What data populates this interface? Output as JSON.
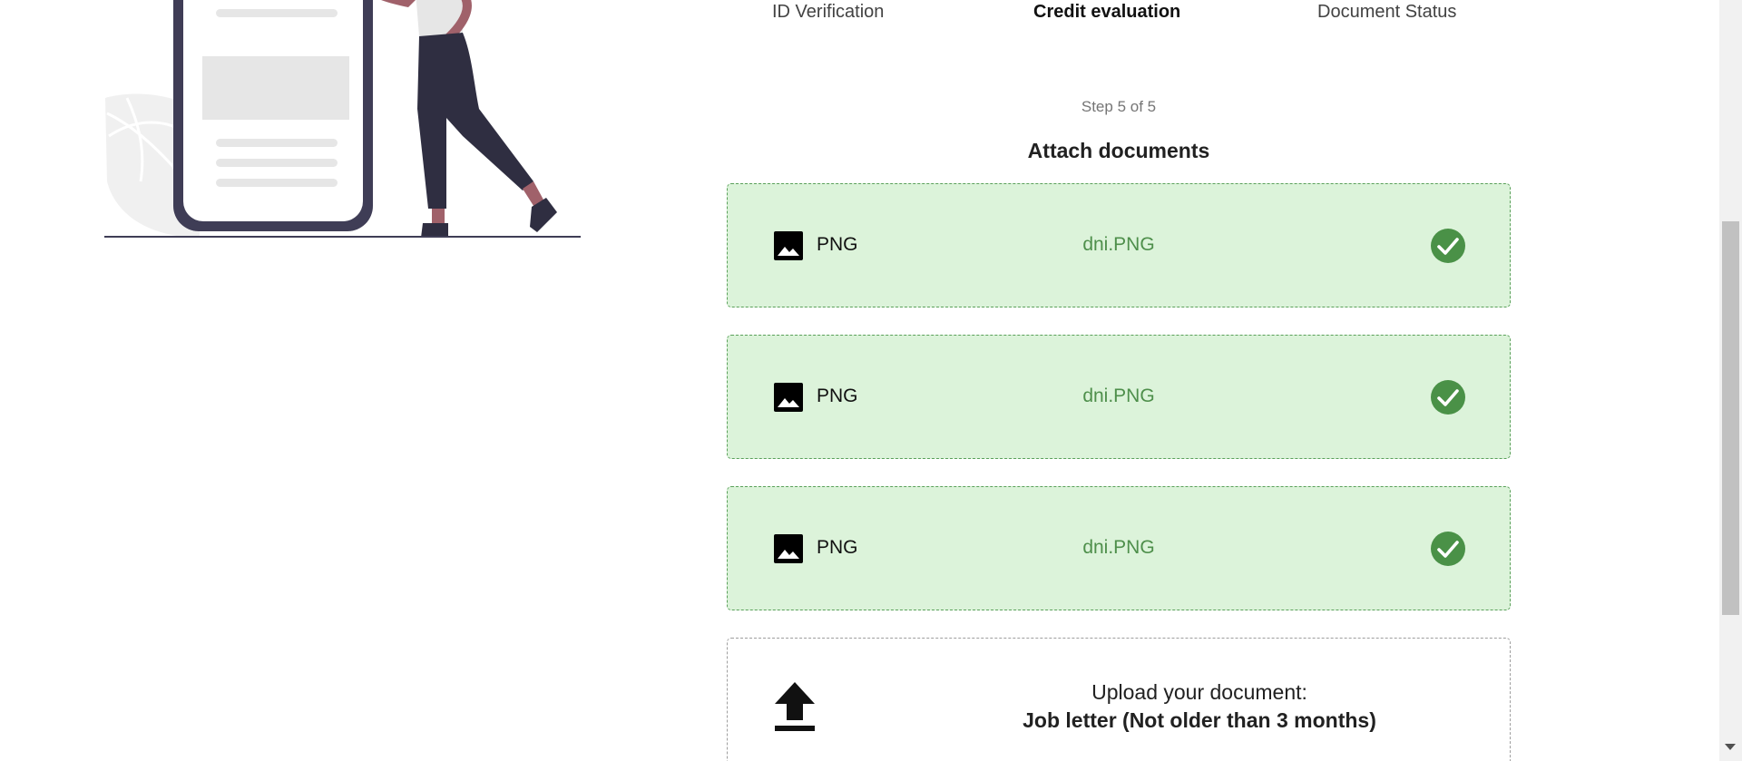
{
  "steps": {
    "items": [
      {
        "label": "ID Verification",
        "active": false
      },
      {
        "label": "Credit evaluation",
        "active": true
      },
      {
        "label": "Document Status",
        "active": false
      }
    ],
    "progress_text": "Step 5 of 5"
  },
  "section_title": "Attach documents",
  "documents": [
    {
      "type_label": "PNG",
      "file_name": "dni.PNG",
      "status": "uploaded",
      "type_icon": "image-icon",
      "status_icon": "check-circle-icon"
    },
    {
      "type_label": "PNG",
      "file_name": "dni.PNG",
      "status": "uploaded",
      "type_icon": "image-icon",
      "status_icon": "check-circle-icon"
    },
    {
      "type_label": "PNG",
      "file_name": "dni.PNG",
      "status": "uploaded",
      "type_icon": "image-icon",
      "status_icon": "check-circle-icon"
    }
  ],
  "upload": {
    "prompt": "Upload your document:",
    "document_name": "Job letter (Not older than 3 months)",
    "icon": "upload-icon"
  },
  "colors": {
    "success_bg": "#dcf3da",
    "success_border": "#5aa05a",
    "success_text": "#4e8f4b",
    "check_circle": "#4a9147",
    "illustration_dark": "#3f3d56",
    "illustration_skin": "#a0616a"
  }
}
